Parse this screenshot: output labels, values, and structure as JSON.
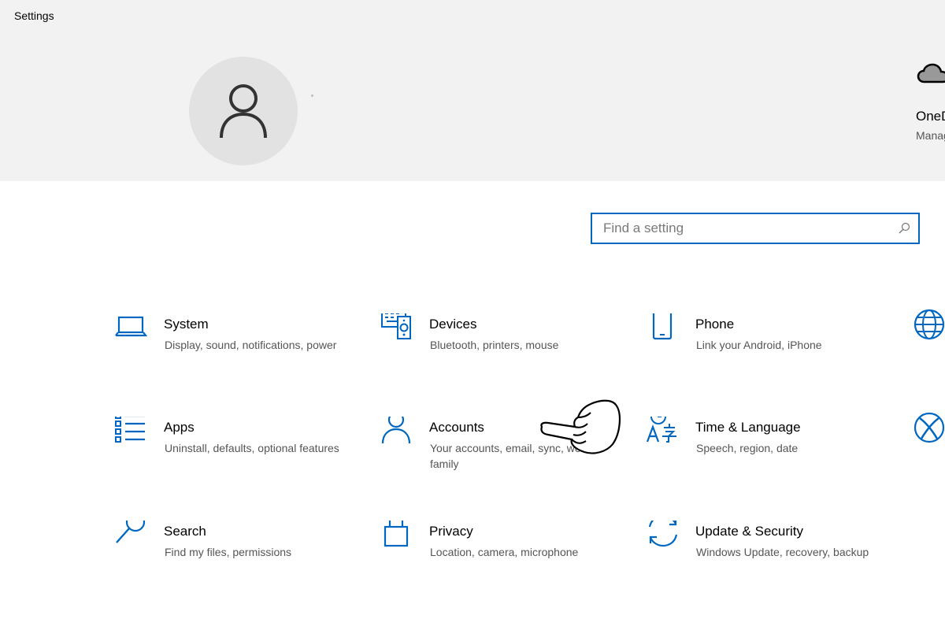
{
  "window": {
    "title": "Settings"
  },
  "onedrive": {
    "title": "OneDrive",
    "subtitle": "Manage"
  },
  "search": {
    "placeholder": "Find a setting"
  },
  "tiles": [
    {
      "id": "system",
      "icon": "laptop-icon",
      "title": "System",
      "description": "Display, sound, notifications, power"
    },
    {
      "id": "devices",
      "icon": "devices-icon",
      "title": "Devices",
      "description": "Bluetooth, printers, mouse"
    },
    {
      "id": "phone",
      "icon": "phone-icon",
      "title": "Phone",
      "description": "Link your Android, iPhone"
    },
    {
      "id": "apps",
      "icon": "apps-list-icon",
      "title": "Apps",
      "description": "Uninstall, defaults, optional features"
    },
    {
      "id": "accounts",
      "icon": "person-icon",
      "title": "Accounts",
      "description": "Your accounts, email, sync, work, family"
    },
    {
      "id": "time",
      "icon": "time-language-icon",
      "title": "Time & Language",
      "description": "Speech, region, date"
    },
    {
      "id": "search",
      "icon": "magnifier-icon",
      "title": "Search",
      "description": "Find my files, permissions"
    },
    {
      "id": "privacy",
      "icon": "lock-icon",
      "title": "Privacy",
      "description": "Location, camera, microphone"
    },
    {
      "id": "update",
      "icon": "sync-arrows-icon",
      "title": "Update & Security",
      "description": "Windows Update, recovery, backup"
    }
  ],
  "colors": {
    "accent": "#0067c0",
    "banner": "#f2f2f2",
    "description_text": "#555555"
  }
}
